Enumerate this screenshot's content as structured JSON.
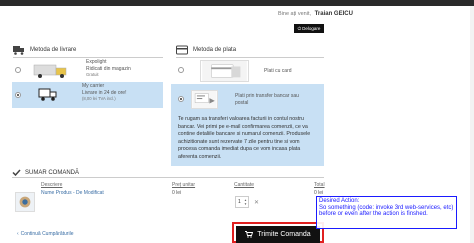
{
  "header": {
    "welcome_text": "Bine ați venit,",
    "user_name": "Traian GEICU",
    "logout_label": "Delogare"
  },
  "shipping": {
    "title": "Metoda de livrare",
    "options": [
      {
        "line1": "Expolight",
        "line2": "Ridicati din magazin",
        "line3": "Gratuit"
      },
      {
        "line1": "My carrier",
        "line2": "Livrare in 24 de ore!",
        "line3": "(8,00 lei TVA incl.)"
      }
    ]
  },
  "payment": {
    "title": "Metoda de plata",
    "options": [
      {
        "label": "Plati cu card"
      },
      {
        "label": "Plati prin transfer bancar sau postal"
      }
    ],
    "info_text": "Te rugam sa transferi valoarea facturii in contul nostru bancar. Vei primi pe e-mail confirmarea comenzii, ce va contine detaliile bancare si numarul comenzii. Produsele achizitionate sunt rezervate 7 zile pentru tine si vom procesa comanda imediat dupa ce vom incasa plata aferenta comenzii."
  },
  "summary": {
    "title": "SUMAR COMANDĂ",
    "columns": [
      "Descriere",
      "Preț unitar",
      "Cantitate",
      "Total"
    ],
    "items": [
      {
        "name": "Nume Produs  - De Modificat",
        "unit_price": "0 lei",
        "quantity": "1",
        "total": "0 lei"
      }
    ]
  },
  "actions": {
    "continue_label": "Continuă Cumpărăturile",
    "submit_label": "Trimite Comanda"
  },
  "annotation": {
    "text": "Desired Action:\nSo something (code: invoke 3rd web-services, etc) before or even after the action is finshed."
  },
  "colors": {
    "selected_bg": "#c8e0f4",
    "submit_bg": "#111111",
    "highlight_red": "#e02020",
    "annotation_blue": "#1a1aff"
  }
}
